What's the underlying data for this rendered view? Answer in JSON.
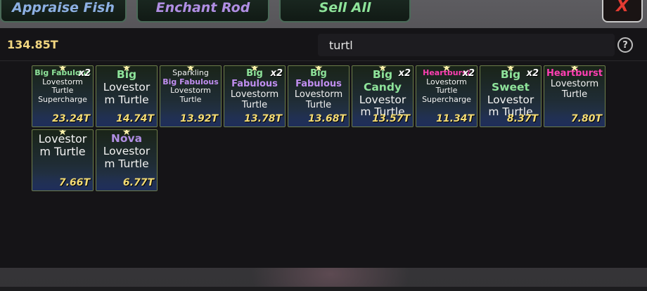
{
  "header": {
    "appraise_label": "Appraise Fish",
    "enchant_label": "Enchant Rod",
    "sell_all_label": "Sell All",
    "close_label": "X"
  },
  "balance": "134.85T",
  "search": {
    "value": "turtl"
  },
  "help_label": "?",
  "colors": {
    "green": "#8ee39a",
    "purple": "#b08ee3",
    "pink": "#ff3fb3",
    "value": "#f3db74"
  },
  "items": [
    {
      "qty": "x2",
      "lines": [
        {
          "text": "Big Fabulous",
          "kind": "mut",
          "color": "#8ee39a",
          "size": "s"
        },
        {
          "text": "Lovestorm",
          "kind": "fish",
          "size": "s"
        },
        {
          "text": "Turtle",
          "kind": "fish",
          "size": "s"
        },
        {
          "text": "Supercharge",
          "kind": "fish",
          "size": "s"
        }
      ],
      "value": "23.24T"
    },
    {
      "qty": "",
      "lines": [
        {
          "text": "Big",
          "kind": "mut",
          "color": "#8ee39a",
          "size": "l"
        },
        {
          "text": "Lovestor",
          "kind": "fish",
          "size": "l"
        },
        {
          "text": "m Turtle",
          "kind": "fish",
          "size": "l"
        }
      ],
      "value": "14.74T"
    },
    {
      "qty": "",
      "lines": [
        {
          "text": "Sparkling",
          "kind": "fish",
          "size": "s"
        },
        {
          "text": "Big Fabulous",
          "kind": "mut",
          "color": "#c08ef0",
          "size": "s"
        },
        {
          "text": "Lovestorm",
          "kind": "fish",
          "size": "s"
        },
        {
          "text": "Turtle",
          "kind": "fish",
          "size": "s"
        }
      ],
      "value": "13.92T"
    },
    {
      "qty": "x2",
      "lines": [
        {
          "text": "Big",
          "kind": "mut",
          "color": "#8ee39a",
          "size": "m"
        },
        {
          "text": "Fabulous",
          "kind": "mut",
          "color": "#c08ef0",
          "size": "m"
        },
        {
          "text": "Lovestorm",
          "kind": "fish",
          "size": "m"
        },
        {
          "text": "Turtle",
          "kind": "fish",
          "size": "m"
        }
      ],
      "value": "13.78T"
    },
    {
      "qty": "",
      "lines": [
        {
          "text": "Big",
          "kind": "mut",
          "color": "#8ee39a",
          "size": "m"
        },
        {
          "text": "Fabulous",
          "kind": "mut",
          "color": "#c08ef0",
          "size": "m"
        },
        {
          "text": "Lovestorm",
          "kind": "fish",
          "size": "m"
        },
        {
          "text": "Turtle",
          "kind": "fish",
          "size": "m"
        }
      ],
      "value": "13.68T"
    },
    {
      "qty": "x2",
      "lines": [
        {
          "text": "Big Candy",
          "kind": "mut",
          "color": "#8ee39a",
          "size": "l"
        },
        {
          "text": "Lovestor",
          "kind": "fish",
          "size": "l"
        },
        {
          "text": "m Turtle",
          "kind": "fish",
          "size": "l"
        }
      ],
      "value": "13.57T"
    },
    {
      "qty": "x2",
      "lines": [
        {
          "text": "Heartburst",
          "kind": "mut",
          "color": "#ff3fb3",
          "size": "s"
        },
        {
          "text": "Lovestorm",
          "kind": "fish",
          "size": "s"
        },
        {
          "text": "Turtle",
          "kind": "fish",
          "size": "s"
        },
        {
          "text": "Supercharge",
          "kind": "fish",
          "size": "s"
        }
      ],
      "value": "11.34T"
    },
    {
      "qty": "x2",
      "lines": [
        {
          "text": "Big Sweet",
          "kind": "mut",
          "color": "#8ee39a",
          "size": "l"
        },
        {
          "text": "Lovestor",
          "kind": "fish",
          "size": "l"
        },
        {
          "text": "m Turtle",
          "kind": "fish",
          "size": "l"
        }
      ],
      "value": "8.37T"
    },
    {
      "qty": "",
      "lines": [
        {
          "text": "Heartburst",
          "kind": "mut",
          "color": "#ff3fb3",
          "size": "m"
        },
        {
          "text": "Lovestorm",
          "kind": "fish",
          "size": "m"
        },
        {
          "text": "Turtle",
          "kind": "fish",
          "size": "m"
        }
      ],
      "value": "7.80T"
    },
    {
      "qty": "",
      "lines": [
        {
          "text": "Lovestor",
          "kind": "fish",
          "size": "xl"
        },
        {
          "text": "m Turtle",
          "kind": "fish",
          "size": "xl"
        }
      ],
      "value": "7.66T"
    },
    {
      "qty": "",
      "lines": [
        {
          "text": "Nova",
          "kind": "mut",
          "color": "#b08ee3",
          "size": "l"
        },
        {
          "text": "Lovestor",
          "kind": "fish",
          "size": "l"
        },
        {
          "text": "m Turtle",
          "kind": "fish",
          "size": "l"
        }
      ],
      "value": "6.77T"
    }
  ]
}
